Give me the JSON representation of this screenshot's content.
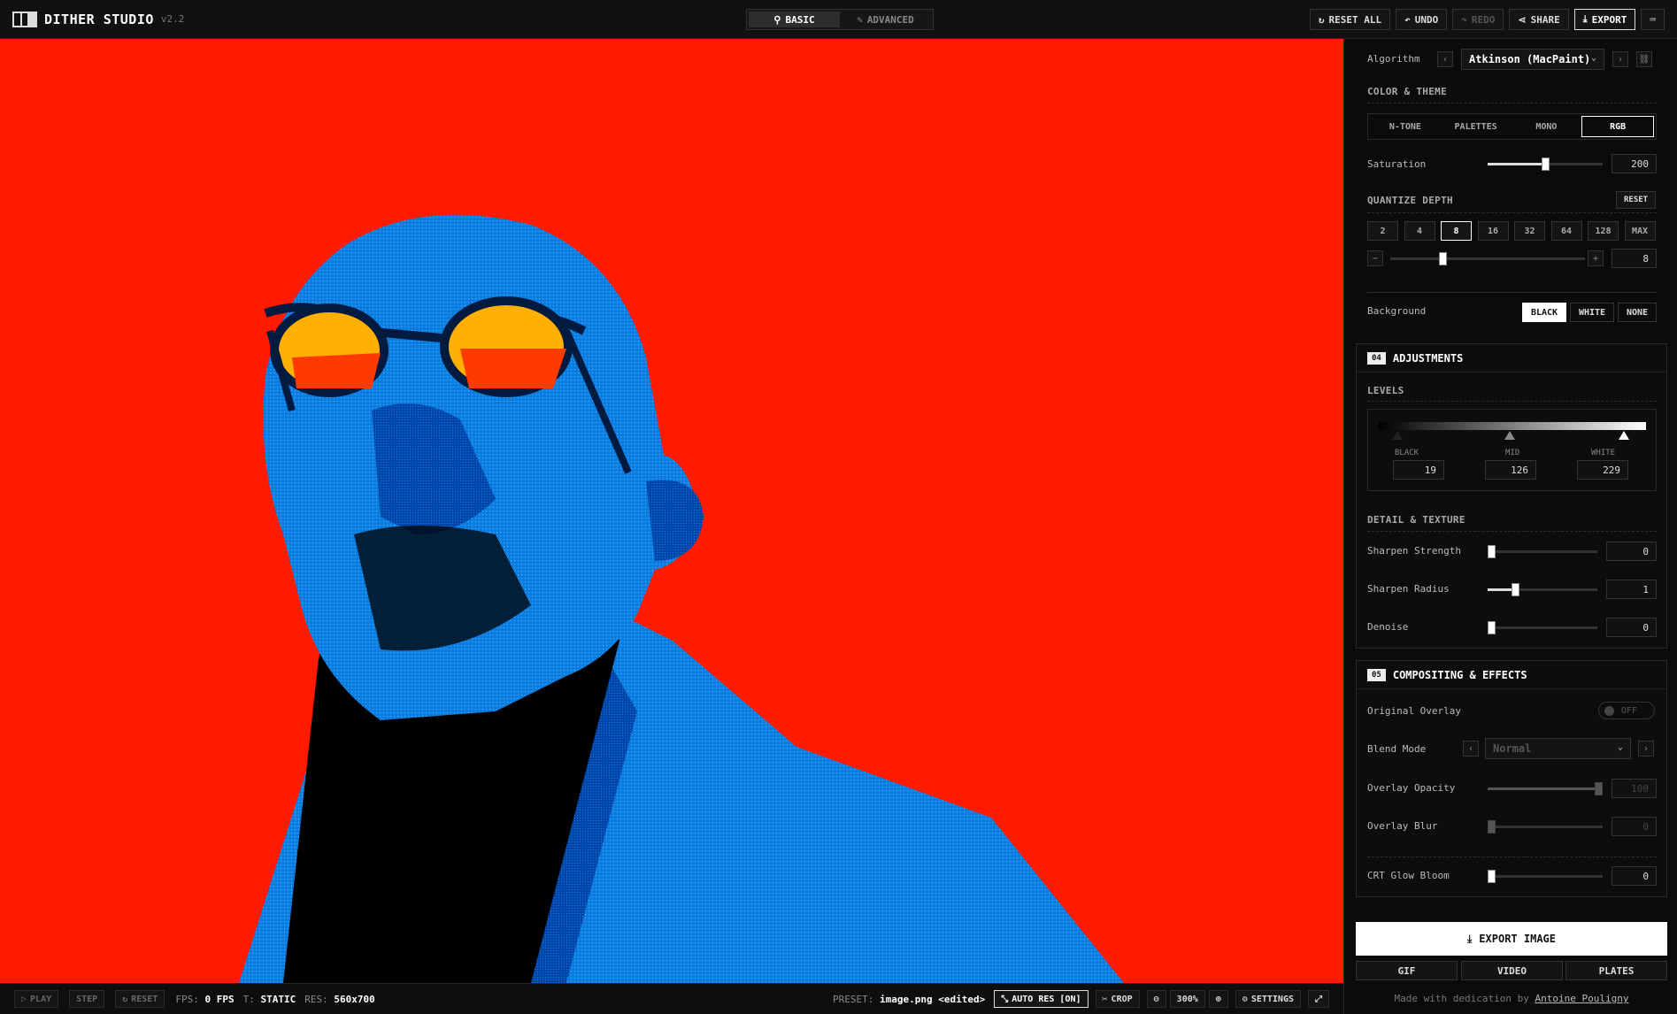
{
  "app": {
    "name": "DITHER STUDIO",
    "version": "v2.2"
  },
  "mode": {
    "basic": "BASIC",
    "advanced": "ADVANCED"
  },
  "topbar": {
    "reset_all": "RESET ALL",
    "undo": "UNDO",
    "redo": "REDO",
    "share": "SHARE",
    "export": "EXPORT"
  },
  "bottom": {
    "play": "PLAY",
    "step": "STEP",
    "reset": "RESET",
    "fps_label": "FPS:",
    "fps_value": "0 FPS",
    "t_label": "T:",
    "t_value": "STATIC",
    "res_label": "RES:",
    "res_value": "560x700",
    "preset_label": "PRESET:",
    "preset_value": "image.png <edited>",
    "auto_res": "AUTO RES [ON]",
    "crop": "CROP",
    "zoom": "300%",
    "settings": "SETTINGS"
  },
  "algorithm": {
    "label": "Algorithm",
    "value": "Atkinson (MacPaint)"
  },
  "color_theme": {
    "title": "COLOR & THEME",
    "modes": [
      "N-TONE",
      "PALETTES",
      "MONO",
      "RGB"
    ],
    "active": "RGB",
    "saturation_label": "Saturation",
    "saturation_value": "200",
    "saturation_fraction": 0.5
  },
  "quantize": {
    "title": "QUANTIZE DEPTH",
    "reset": "RESET",
    "options": [
      "2",
      "4",
      "8",
      "16",
      "32",
      "64",
      "128",
      "MAX"
    ],
    "active": "8",
    "value": "8",
    "slider_fraction": 0.27,
    "minus": "−",
    "plus": "+"
  },
  "background": {
    "label": "Background",
    "options": [
      "BLACK",
      "WHITE",
      "NONE"
    ],
    "active": "BLACK"
  },
  "adjustments": {
    "num": "04",
    "title": "ADJUSTMENTS",
    "levels_title": "LEVELS",
    "black_label": "BLACK",
    "black_value": "19",
    "mid_label": "MID",
    "mid_value": "126",
    "white_label": "WHITE",
    "white_value": "229",
    "detail_title": "DETAIL & TEXTURE",
    "sharpen_strength_label": "Sharpen Strength",
    "sharpen_strength_value": "0",
    "sharpen_radius_label": "Sharpen Radius",
    "sharpen_radius_value": "1",
    "sharpen_radius_fraction": 0.25,
    "denoise_label": "Denoise",
    "denoise_value": "0"
  },
  "compositing": {
    "num": "05",
    "title": "COMPOSITING & EFFECTS",
    "overlay_label": "Original Overlay",
    "overlay_state": "OFF",
    "blend_label": "Blend Mode",
    "blend_value": "Normal",
    "opacity_label": "Overlay Opacity",
    "opacity_value": "100",
    "blur_label": "Overlay Blur",
    "blur_value": "0",
    "crt_label": "CRT Glow Bloom",
    "crt_value": "0"
  },
  "export": {
    "main": "EXPORT IMAGE",
    "gif": "GIF",
    "video": "VIDEO",
    "plates": "PLATES",
    "credit_prefix": "Made with dedication by",
    "credit_name": "Antoine Pouligny"
  },
  "colors": {
    "canvas_bg": "#ff1a00",
    "figure": "#0a7de0",
    "figure_dark": "#0046a8",
    "lens": "#ffb000"
  }
}
